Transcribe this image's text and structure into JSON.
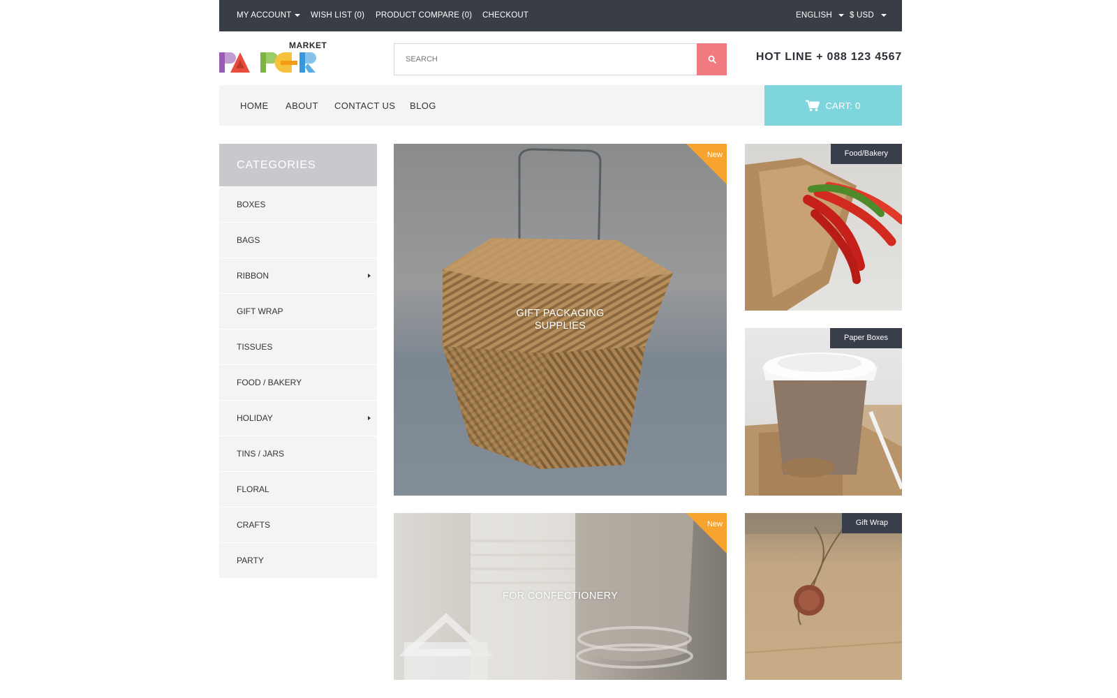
{
  "topbar": {
    "my_account": "MY ACCOUNT",
    "wish_list": "WISH LIST (0)",
    "product_compare": "PRODUCT COMPARE (0)",
    "checkout": "CHECKOUT",
    "language": "ENGLISH",
    "currency": "$ USD"
  },
  "header": {
    "logo_market": "MARKET",
    "logo_text": "PAPER",
    "search_placeholder": "SEARCH",
    "search_icon": "search-icon",
    "hotline": "HOT LINE + 088 123 4567"
  },
  "nav": {
    "links": [
      "HOME",
      "ABOUT",
      "CONTACT US",
      "BLOG"
    ],
    "cart_label": "CART: 0",
    "cart_icon": "cart-icon"
  },
  "sidebar": {
    "title": "CATEGORIES",
    "items": [
      {
        "label": "BOXES"
      },
      {
        "label": "BAGS"
      },
      {
        "label": "RIBBON",
        "has_submenu": true
      },
      {
        "label": "GIFT WRAP"
      },
      {
        "label": "TISSUES"
      },
      {
        "label": "FOOD / BAKERY"
      },
      {
        "label": "HOLIDAY",
        "has_submenu": true
      },
      {
        "label": "TINS / JARS"
      },
      {
        "label": "FLORAL"
      },
      {
        "label": "CRAFTS"
      },
      {
        "label": "PARTY"
      }
    ]
  },
  "banners": {
    "main1": {
      "title_line1": "GIFT PACKAGING",
      "title_line2": "SUPPLIES",
      "ribbon": "New"
    },
    "main2": {
      "title": "FOR CONFECTIONERY",
      "ribbon": "New"
    },
    "side1": {
      "tag": "Food/Bakery"
    },
    "side2": {
      "tag": "Paper Boxes"
    },
    "side3": {
      "tag": "Gift Wrap"
    }
  },
  "colors": {
    "topbar_bg": "#393e46",
    "search_button": "#f07a7f",
    "cart_bg": "#7fd5dc",
    "ribbon": "#f7a330",
    "tag_bg": "#393e4b",
    "category_header": "#c8c9cc"
  }
}
